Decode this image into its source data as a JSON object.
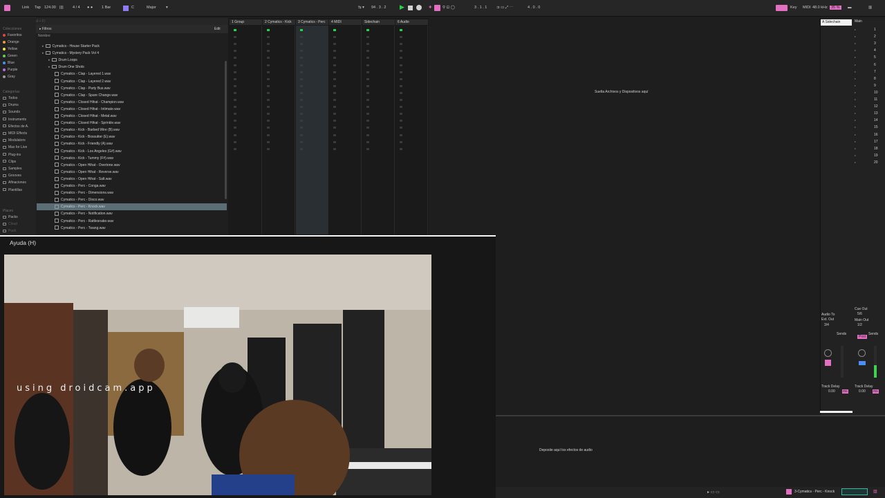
{
  "transport": {
    "link": "Link",
    "tap": "Tap",
    "tempo": "124.00",
    "signature": "4 / 4",
    "quantization": "1 Bar",
    "key": "C",
    "scale": "Major",
    "position": "94 . 3 . 2",
    "loop_start": "3 . 1 . 1",
    "loop_length": "4 . 0 . 0",
    "key_label": "Key",
    "midi_label": "MIDI",
    "sample_rate": "48.0 kHz",
    "cpu": "35 %"
  },
  "browser": {
    "search_placeholder": "Buscar (Cmd + F)",
    "filters": "Filtros",
    "edit": "Edit",
    "name_header": "Nombre",
    "collections_title": "Colecciones",
    "collections": [
      {
        "label": "Favoritos",
        "color": "#e0463d"
      },
      {
        "label": "Orange",
        "color": "#f19a38"
      },
      {
        "label": "Yellow",
        "color": "#f3e24a"
      },
      {
        "label": "Green",
        "color": "#5fcf5a"
      },
      {
        "label": "Blue",
        "color": "#4c8ff2"
      },
      {
        "label": "Purple",
        "color": "#b46ee8"
      },
      {
        "label": "Gray",
        "color": "#9a9a9a"
      }
    ],
    "categories_title": "Categorías",
    "categories": [
      "Todos",
      "Drums",
      "Sounds",
      "Instruments",
      "Efectos de A.",
      "MIDI Effects",
      "Modulators",
      "Max for Live",
      "Plug-ins",
      "Clips",
      "Samples",
      "Grooves",
      "Afinaciones",
      "Plantillas"
    ],
    "places_title": "Places",
    "places": [
      "Packs",
      "Cloud",
      "Push"
    ],
    "tree": [
      {
        "label": "Cymatics - House Starter Pack",
        "type": "folder",
        "indent": 1
      },
      {
        "label": "Cymatics - Mystery Pack Vol 4",
        "type": "folder",
        "indent": 1
      },
      {
        "label": "Drum Loops",
        "type": "folder",
        "indent": 2
      },
      {
        "label": "Drum One Shots",
        "type": "folder",
        "indent": 2
      },
      {
        "label": "Cymatics - Clap - Layered 1.wav",
        "type": "file",
        "indent": 3
      },
      {
        "label": "Cymatics - Clap - Layered 2.wav",
        "type": "file",
        "indent": 3
      },
      {
        "label": "Cymatics - Clap - Party Bus.wav",
        "type": "file",
        "indent": 3
      },
      {
        "label": "Cymatics - Clap - Spare Change.wav",
        "type": "file",
        "indent": 3
      },
      {
        "label": "Cymatics - Closed Hihat - Champion.wav",
        "type": "file",
        "indent": 3
      },
      {
        "label": "Cymatics - Closed Hihat - Intimate.wav",
        "type": "file",
        "indent": 3
      },
      {
        "label": "Cymatics - Closed Hihat - Metal.wav",
        "type": "file",
        "indent": 3
      },
      {
        "label": "Cymatics - Closed Hihat - Sprinkle.wav",
        "type": "file",
        "indent": 3
      },
      {
        "label": "Cymatics - Kick - Barbed Wire (B).wav",
        "type": "file",
        "indent": 3
      },
      {
        "label": "Cymatics - Kick - Bossutter (E).wav",
        "type": "file",
        "indent": 3
      },
      {
        "label": "Cymatics - Kick - Friendly (A).wav",
        "type": "file",
        "indent": 3
      },
      {
        "label": "Cymatics - Kick - Los Angeles (G#).wav",
        "type": "file",
        "indent": 3
      },
      {
        "label": "Cymatics - Kick - Tummy (F#).wav",
        "type": "file",
        "indent": 3
      },
      {
        "label": "Cymatics - Open Hihat - Overtone.wav",
        "type": "file",
        "indent": 3
      },
      {
        "label": "Cymatics - Open Hihat - Reverse.wav",
        "type": "file",
        "indent": 3
      },
      {
        "label": "Cymatics - Open Hihat - Salt.wav",
        "type": "file",
        "indent": 3
      },
      {
        "label": "Cymatics - Perc - Conga.wav",
        "type": "file",
        "indent": 3
      },
      {
        "label": "Cymatics - Perc - Dimensions.wav",
        "type": "file",
        "indent": 3
      },
      {
        "label": "Cymatics - Perc - Disco.wav",
        "type": "file",
        "indent": 3
      },
      {
        "label": "Cymatics - Perc - Knock.wav",
        "type": "file",
        "indent": 3,
        "selected": true
      },
      {
        "label": "Cymatics - Perc - Notification.wav",
        "type": "file",
        "indent": 3
      },
      {
        "label": "Cymatics - Perc - Rattlesnake.wav",
        "type": "file",
        "indent": 3
      },
      {
        "label": "Cymatics - Perc - Twang.wav",
        "type": "file",
        "indent": 3
      }
    ]
  },
  "session": {
    "tracks": [
      {
        "label": "1 Group",
        "color": "#6d6d6d"
      },
      {
        "label": "2 Cymatics - Kick",
        "color": "#6d6d6d"
      },
      {
        "label": "3 Cymatics - Perc",
        "color": "#6d6d6d"
      },
      {
        "label": "4 MIDI",
        "color": "#6d6d6d"
      },
      {
        "label": "Sidechain",
        "color": "#6d6d6d"
      },
      {
        "label": "6 Audio",
        "color": "#6d6d6d"
      }
    ],
    "drop_hint": "Suelta Archivos y Dispositivos aquí",
    "scenes": [
      "1",
      "2",
      "3",
      "4",
      "5",
      "6",
      "7",
      "8",
      "9",
      "10",
      "11",
      "12",
      "13",
      "14",
      "15",
      "16",
      "17",
      "18",
      "19",
      "20"
    ]
  },
  "mixer": {
    "sidechain_tab": "A Sidechain",
    "main_tab": "Main",
    "audio_to": "Audio To",
    "audio_to_value": "Ext. Out",
    "audio_to_channel": "3/4",
    "cue_out": "Cue Out",
    "cue_out_value": "5/6",
    "main_out": "Main Out",
    "main_out_value": "1/2",
    "sends": "Sends",
    "post": "Post",
    "track_delay": "Track Delay",
    "track_delay_value": "0.00",
    "ms": "ms"
  },
  "help": {
    "title": "Ayuda (H)",
    "watermark": "using droidcam.app"
  },
  "device": {
    "hint": "Deposite aquí los efectos de audio"
  },
  "status": {
    "selected_track": "3-Cymatics - Perc - Knock"
  }
}
